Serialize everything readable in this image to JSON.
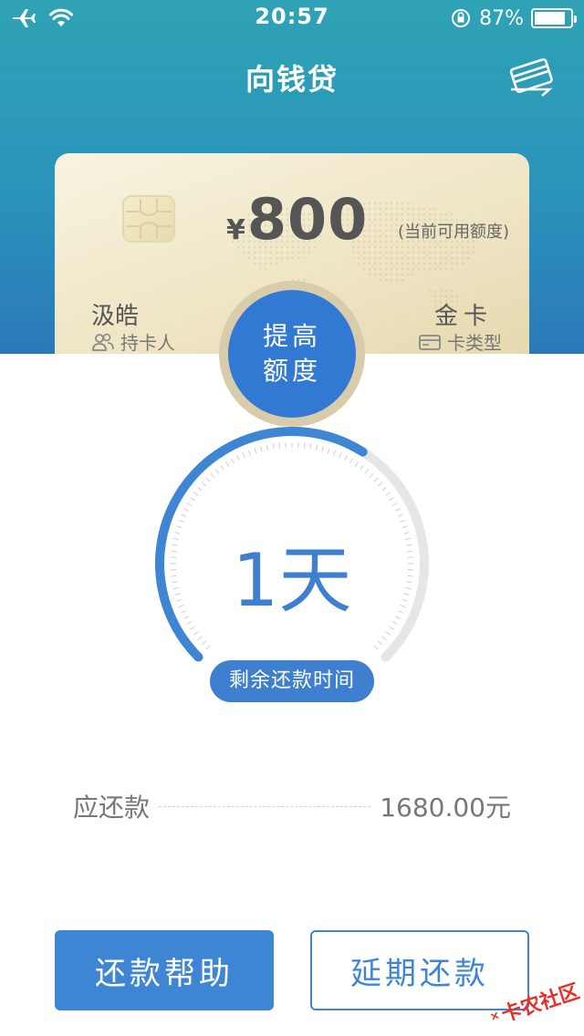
{
  "status_bar": {
    "time": "20:57",
    "battery": "87%",
    "battery_level": 0.87
  },
  "nav": {
    "title": "向钱贷"
  },
  "card": {
    "currency": "¥",
    "amount": "800",
    "amount_note": "(当前可用额度)",
    "holder_name": "汲皓",
    "holder_label": "持卡人",
    "type_name": "金卡",
    "type_label": "卡类型"
  },
  "raise_button": {
    "line1": "提高",
    "line2": "额度"
  },
  "countdown": {
    "value": "1天",
    "label": "剩余还款时间",
    "progress": 0.62
  },
  "due": {
    "label": "应还款",
    "amount": "1680.00元"
  },
  "buttons": {
    "help": "还款帮助",
    "extend": "延期还款"
  },
  "watermark": {
    "text": "卡农社区"
  },
  "colors": {
    "primary": "#3e86d4",
    "header_top": "#2fa3b5",
    "header_bottom": "#2b79b8",
    "card_gold": "#efe6c6"
  }
}
